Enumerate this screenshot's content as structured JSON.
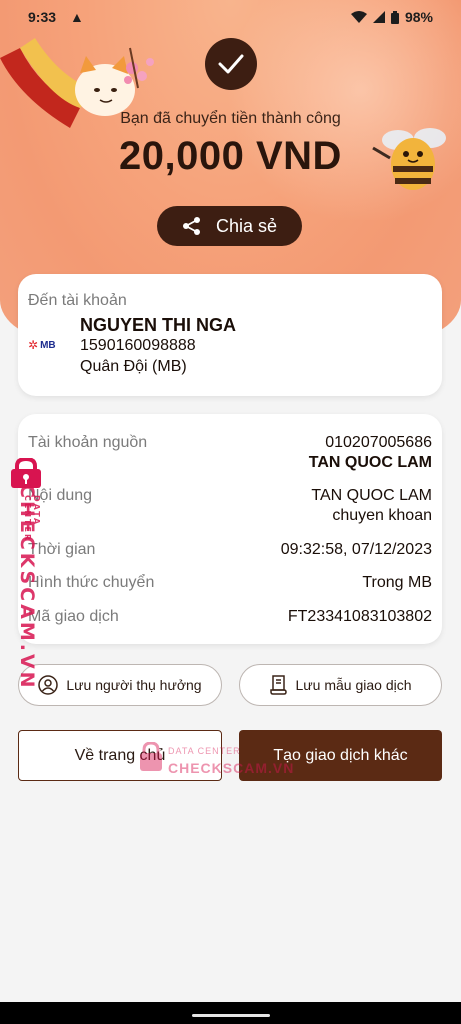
{
  "status_bar": {
    "time": "9:33",
    "battery": "98%"
  },
  "header": {
    "success_message": "Bạn đã chuyển tiền thành công",
    "amount": "20,000 VND",
    "share_label": "Chia sẻ"
  },
  "recipient": {
    "section_label": "Đến tài khoản",
    "bank_logo": "MB",
    "name": "NGUYEN THI NGA",
    "account_number": "1590160098888",
    "bank_name": "Quân Đội (MB)"
  },
  "details": {
    "source_label": "Tài khoản nguồn",
    "source_account": "010207005686",
    "source_name": "TAN QUOC LAM",
    "content_label": "Nội dung",
    "content_line1": "TAN QUOC LAM",
    "content_line2": "chuyen khoan",
    "time_label": "Thời gian",
    "time_value": "09:32:58, 07/12/2023",
    "method_label": "Hình thức chuyển",
    "method_value": "Trong MB",
    "txn_label": "Mã giao dịch",
    "txn_value": "FT23341083103802"
  },
  "actions": {
    "save_beneficiary": "Lưu người thụ hưởng",
    "save_template": "Lưu mẫu giao dịch",
    "home": "Về trang chủ",
    "new_transaction": "Tạo giao dịch khác"
  },
  "watermark": {
    "brand": "CHECKSCAM.VN",
    "sub": "DATA CENTER"
  },
  "colors": {
    "accent_dark": "#3d1e12",
    "button_brown": "#5b2a14",
    "hero_peach": "#f6a27a",
    "watermark_pink": "#d81450"
  }
}
